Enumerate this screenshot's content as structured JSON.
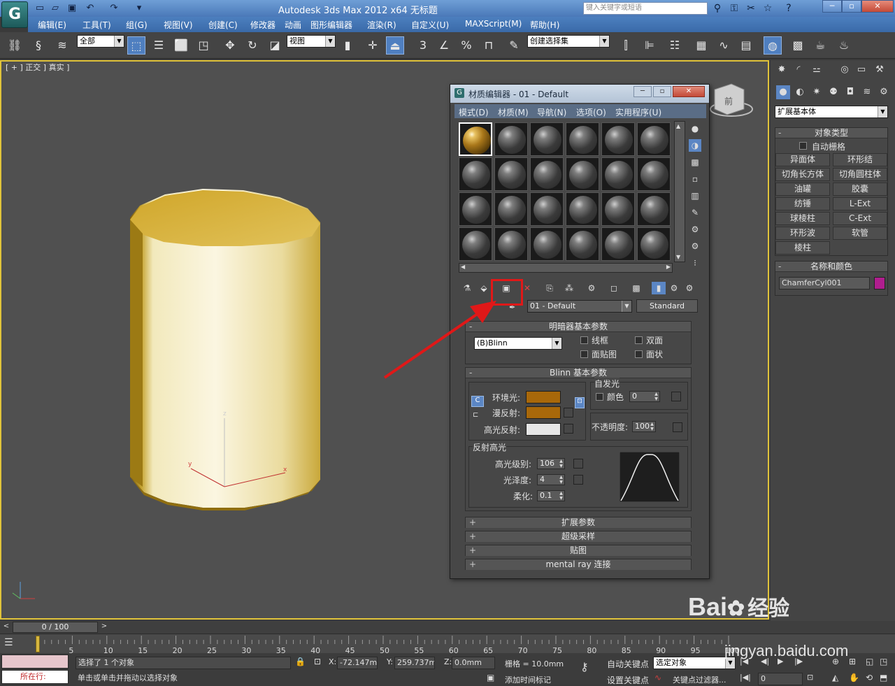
{
  "titlebar": {
    "app_title": "Autodesk 3ds Max  2012 x64      无标题",
    "search_placeholder": "键入关键字或短语",
    "logo_glyph": "G",
    "quick_access_icons": [
      "new-file-icon",
      "open-file-icon",
      "save-file-icon",
      "undo-icon",
      "redo-icon",
      "customize-icon"
    ]
  },
  "menubar": {
    "items": [
      "编辑(E)",
      "工具(T)",
      "组(G)",
      "视图(V)",
      "创建(C)",
      "修改器",
      "动画",
      "图形编辑器",
      "渲染(R)",
      "自定义(U)",
      "MAXScript(M)",
      "帮助(H)"
    ]
  },
  "toolbar": {
    "selection_filter": "全部",
    "reference_coord": "视图",
    "named_selection": "创建选择集",
    "snap_label": "3"
  },
  "viewport": {
    "label": "[ + ] 正交 ] 真实 ]",
    "viewcube_label": "前",
    "gizmo_x": "x",
    "gizmo_y": "y",
    "gizmo_z": "z"
  },
  "command_panel": {
    "category": "扩展基本体",
    "object_type_title": "对象类型",
    "autogrid_label": "自动栅格",
    "object_buttons": [
      "异面体",
      "环形结",
      "切角长方体",
      "切角圆柱体",
      "油罐",
      "胶囊",
      "纺锤",
      "L-Ext",
      "球棱柱",
      "C-Ext",
      "环形波",
      "软管",
      "棱柱"
    ],
    "name_color_title": "名称和颜色",
    "object_name": "ChamferCyl001",
    "object_color": "#b01e8e"
  },
  "material_editor": {
    "title": "材质编辑器 - 01 - Default",
    "menus": [
      "模式(D)",
      "材质(M)",
      "导航(N)",
      "选项(O)",
      "实用程序(U)"
    ],
    "material_name": "01 - Default",
    "material_type": "Standard",
    "shader_rollout": {
      "title": "明暗器基本参数",
      "shader": "(B)Blinn",
      "wire": "线框",
      "two_sided": "双面",
      "face_map": "面贴图",
      "faceted": "面状"
    },
    "blinn_rollout": {
      "title": "Blinn 基本参数",
      "self_illum_title": "自发光",
      "self_illum_color_label": "颜色",
      "self_illum_value": "0",
      "ambient_label": "环境光:",
      "diffuse_label": "漫反射:",
      "specular_label": "高光反射:",
      "ambient_color": "#a8680a",
      "diffuse_color": "#a8680a",
      "specular_color": "#e6e6e6",
      "opacity_label": "不透明度:",
      "opacity_value": "100",
      "spec_highlights_title": "反射高光",
      "spec_level_label": "高光级别:",
      "spec_level_value": "106",
      "glossiness_label": "光泽度:",
      "glossiness_value": "4",
      "soften_label": "柔化:",
      "soften_value": "0.1"
    },
    "collapsed_rollouts": [
      "扩展参数",
      "超级采样",
      "贴图",
      "mental ray 连接"
    ]
  },
  "timeline": {
    "frame_readout": "0 / 100",
    "ticks": [
      "0",
      "5",
      "10",
      "15",
      "20",
      "25",
      "30",
      "35",
      "40",
      "45",
      "50",
      "55",
      "60",
      "65",
      "70",
      "75",
      "80",
      "85",
      "90",
      "95",
      "100"
    ]
  },
  "status": {
    "location_label": "所在行:",
    "selection_info": "选择了 1 个对象",
    "prompt": "单击或单击并拖动以选择对象",
    "x_label": "X:",
    "x_value": "-72.147mm",
    "y_label": "Y:",
    "y_value": "259.737mm",
    "z_label": "Z:",
    "z_value": "0.0mm",
    "grid": "栅格 = 10.0mm",
    "auto_key": "自动关键点",
    "set_key": "设置关键点",
    "selected_dropdown": "选定对象",
    "key_filters": "关键点过滤器...",
    "add_time_tag": "添加时间标记",
    "frame_field": "0"
  },
  "watermark": {
    "brand": "Bai",
    "brand2": "经验",
    "url": "jingyan.baidu.com"
  }
}
